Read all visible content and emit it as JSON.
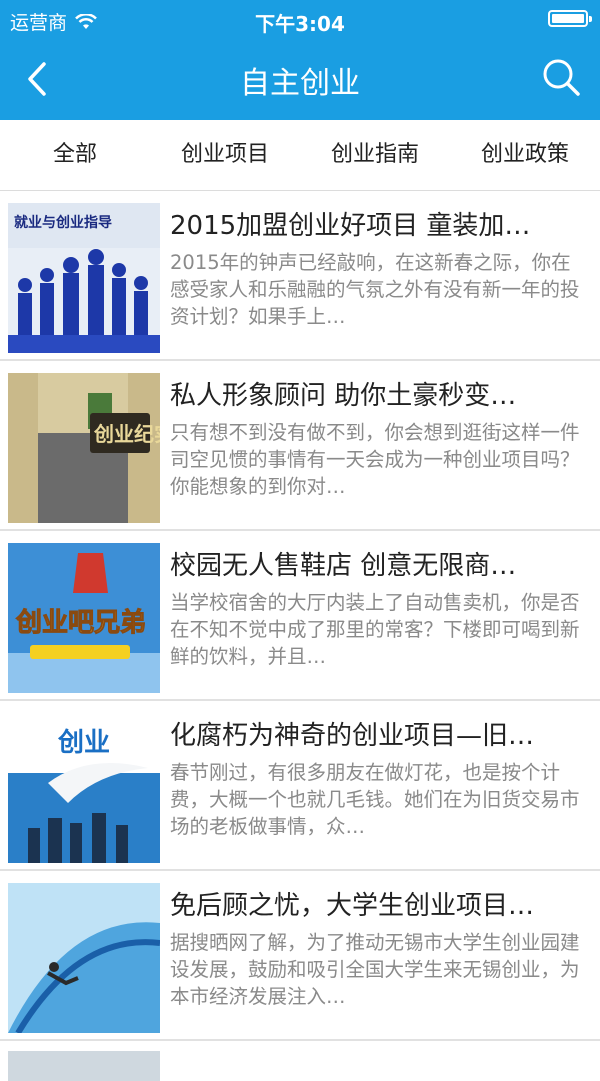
{
  "status": {
    "carrier": "运营商",
    "time": "下午3:04"
  },
  "nav": {
    "title": "自主创业"
  },
  "tabs": [
    "全部",
    "创业项目",
    "创业指南",
    "创业政策"
  ],
  "items": [
    {
      "title": "2015加盟创业好项目 童装加…",
      "desc": "2015年的钟声已经敲响，在这新春之际，你在感受家人和乐融融的气氛之外有没有新一年的投资计划？如果手上…",
      "thumb_text": "就业与创业指导"
    },
    {
      "title": "私人形象顾问 助你土豪秒变…",
      "desc": "只有想不到没有做不到，你会想到逛街这样一件司空见惯的事情有一天会成为一种创业项目吗？你能想象的到你对…",
      "thumb_text": "创业纪实"
    },
    {
      "title": "校园无人售鞋店 创意无限商…",
      "desc": "当学校宿舍的大厅内装上了自动售卖机，你是否在不知不觉中成了那里的常客？下楼即可喝到新鲜的饮料，并且…",
      "thumb_text": "创业吧兄弟"
    },
    {
      "title": "化腐朽为神奇的创业项目—旧…",
      "desc": "春节刚过，有很多朋友在做灯花，也是按个计费，大概一个也就几毛钱。她们在为旧货交易市场的老板做事情，众…",
      "thumb_text": "创业"
    },
    {
      "title": "免后顾之忧，大学生创业项目…",
      "desc": "据搜晒网了解，为了推动无锡市大学生创业园建设发展，鼓励和吸引全国大学生来无锡创业，为本市经济发展注入…",
      "thumb_text": ""
    }
  ]
}
